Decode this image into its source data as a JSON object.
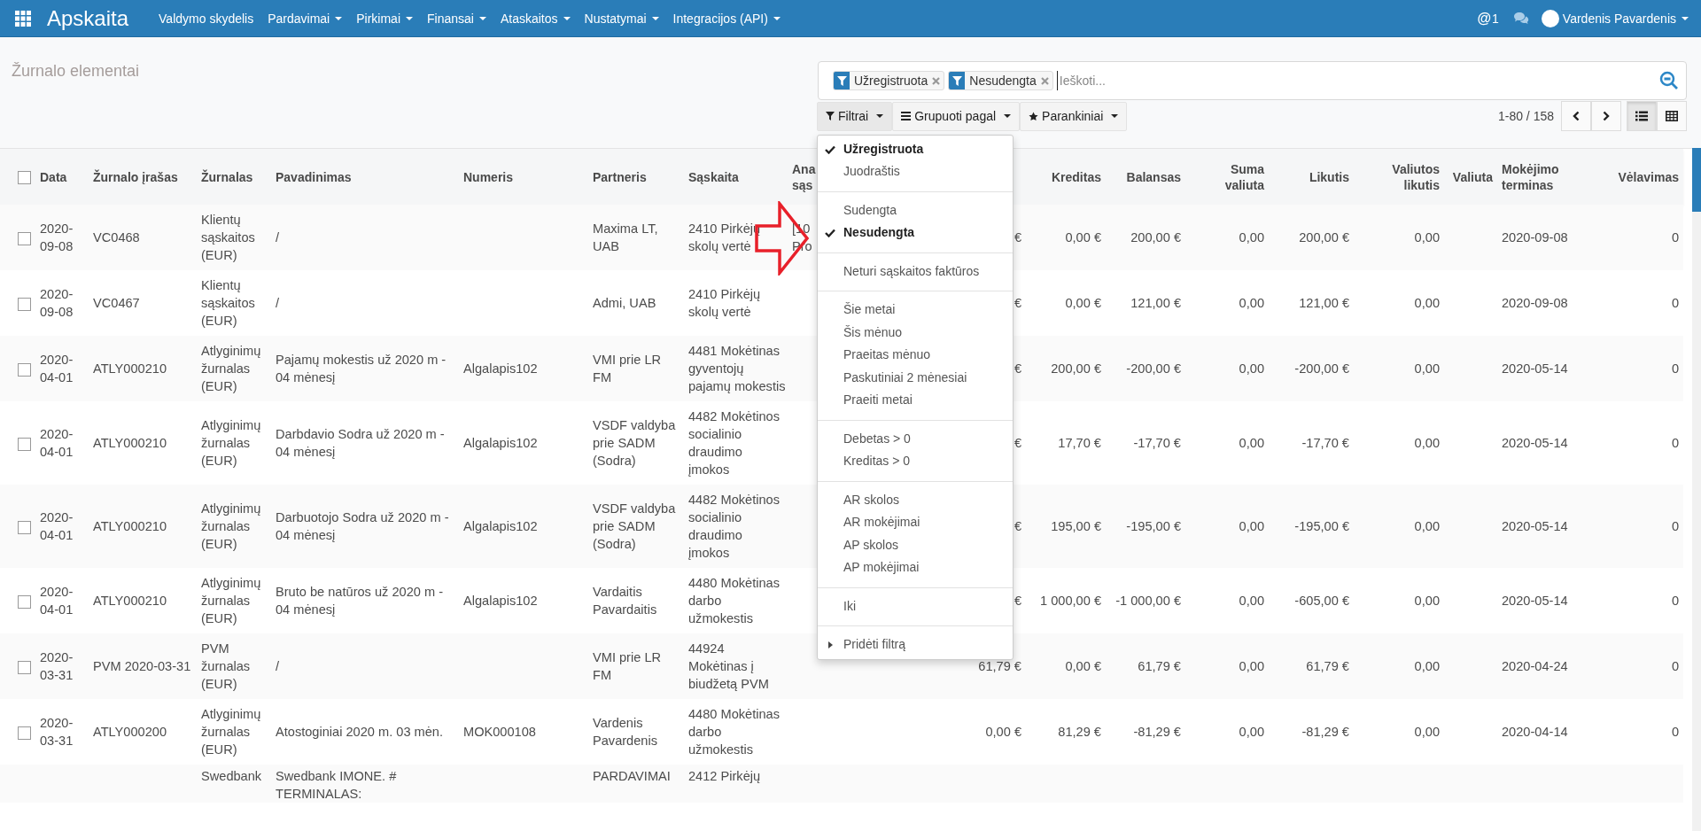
{
  "nav": {
    "app_title": "Apskaita",
    "menus": [
      {
        "label": "Valdymo skydelis",
        "caret": false
      },
      {
        "label": "Pardavimai",
        "caret": true
      },
      {
        "label": "Pirkimai",
        "caret": true
      },
      {
        "label": "Finansai",
        "caret": true
      },
      {
        "label": "Ataskaitos",
        "caret": true
      },
      {
        "label": "Nustatymai",
        "caret": true
      },
      {
        "label": "Integracijos (API)",
        "caret": true
      }
    ],
    "mention_glyph": "@",
    "mention_count": "1",
    "user": "Vardenis Pavardenis"
  },
  "page_title": "Žurnalo elementai",
  "search": {
    "facets": [
      {
        "label": "Užregistruota"
      },
      {
        "label": "Nesudengta"
      }
    ],
    "placeholder": "Ieškoti..."
  },
  "toolbar": [
    {
      "kind": "filter",
      "label": "Filtrai",
      "expanded": true
    },
    {
      "kind": "group",
      "label": "Grupuoti pagal",
      "expanded": false
    },
    {
      "kind": "favorite",
      "label": "Parankiniai",
      "expanded": false
    }
  ],
  "pager": "1-80 / 158",
  "views": [
    {
      "kind": "list",
      "selected": true
    },
    {
      "kind": "grid",
      "selected": false
    }
  ],
  "filter_menu": [
    [
      {
        "label": "Užregistruota",
        "checked": true
      },
      {
        "label": "Juodraštis",
        "checked": false
      }
    ],
    [
      {
        "label": "Sudengta",
        "checked": false
      },
      {
        "label": "Nesudengta",
        "checked": true
      }
    ],
    [
      {
        "label": "Neturi sąskaitos faktūros",
        "checked": false
      }
    ],
    [
      {
        "label": "Šie metai",
        "checked": false
      },
      {
        "label": "Šis mėnuo",
        "checked": false
      },
      {
        "label": "Praeitas mėnuo",
        "checked": false
      },
      {
        "label": "Paskutiniai 2 mėnesiai",
        "checked": false
      },
      {
        "label": "Praeiti metai",
        "checked": false
      }
    ],
    [
      {
        "label": "Debetas > 0",
        "checked": false
      },
      {
        "label": "Kreditas > 0",
        "checked": false
      }
    ],
    [
      {
        "label": "AR skolos",
        "checked": false
      },
      {
        "label": "AR mokėjimai",
        "checked": false
      },
      {
        "label": "AP skolos",
        "checked": false
      },
      {
        "label": "AP mokėjimai",
        "checked": false
      }
    ],
    [
      {
        "label": "Iki",
        "checked": false
      }
    ],
    [
      {
        "label": "Pridėti filtrą",
        "checked": false,
        "kind": "submenu"
      }
    ]
  ],
  "table": {
    "all_selected": false,
    "columns": [
      {
        "label": "Data",
        "kind": "text"
      },
      {
        "label": "Žurnalo įrašas",
        "kind": "text"
      },
      {
        "label": "Žurnalas",
        "kind": "text"
      },
      {
        "label": "Pavadinimas",
        "kind": "text"
      },
      {
        "label": "Numeris",
        "kind": "text"
      },
      {
        "label": "Partneris",
        "kind": "text"
      },
      {
        "label": "Sąskaita",
        "kind": "text"
      },
      {
        "label": "Ana sąs",
        "kind": "text"
      },
      {
        "kind": "number"
      },
      {
        "label": "Kreditas",
        "kind": "number"
      },
      {
        "label": "Balansas",
        "kind": "number"
      },
      {
        "label": "Suma valiuta",
        "kind": "number"
      },
      {
        "label": "Likutis",
        "kind": "number"
      },
      {
        "label": "Valiutos likutis",
        "kind": "number"
      },
      {
        "label": "Valiuta",
        "kind": "number"
      },
      {
        "label": "Mokėjimo terminas",
        "kind": "text"
      },
      {
        "label": "Vėlavimas",
        "kind": "number"
      }
    ],
    "rows": [
      {
        "checked": false,
        "date": "2020-09-08",
        "entry": "VC0468",
        "journal": "Klientų sąskaitos (EUR)",
        "name": "/",
        "partner": "Maxima LT, UAB",
        "account": "2410 Pirkėjų skolų vertė",
        "analytic": "[10 Pro",
        "debit": "€",
        "credit": "0,00 €",
        "balance": "200,00 €",
        "amount_currency": "0,00",
        "residual": "200,00 €",
        "residual_currency": "0,00",
        "due": "2020-09-08",
        "delay": "0"
      },
      {
        "checked": false,
        "date": "2020-09-08",
        "entry": "VC0467",
        "journal": "Klientų sąskaitos (EUR)",
        "name": "/",
        "partner": "Admi, UAB",
        "account": "2410 Pirkėjų skolų vertė",
        "debit": "€",
        "credit": "0,00 €",
        "balance": "121,00 €",
        "amount_currency": "0,00",
        "residual": "121,00 €",
        "residual_currency": "0,00",
        "due": "2020-09-08",
        "delay": "0"
      },
      {
        "checked": false,
        "date": "2020-04-01",
        "entry": "ATLY000210",
        "journal": "Atlyginimų žurnalas (EUR)",
        "name": "Pajamų mokestis už 2020 m - 04 mėnesį",
        "number": "Algalapis102",
        "partner": "VMI prie LR FM",
        "account": "4481 Mokėtinas gyventojų pajamų mokestis",
        "debit": "€",
        "credit": "200,00 €",
        "balance": "-200,00 €",
        "amount_currency": "0,00",
        "residual": "-200,00 €",
        "residual_currency": "0,00",
        "due": "2020-05-14",
        "delay": "0"
      },
      {
        "checked": false,
        "date": "2020-04-01",
        "entry": "ATLY000210",
        "journal": "Atlyginimų žurnalas (EUR)",
        "name": "Darbdavio Sodra už 2020 m - 04 mėnesį",
        "number": "Algalapis102",
        "partner": "VSDF valdyba prie SADM (Sodra)",
        "account": "4482 Mokėtinos socialinio draudimo įmokos",
        "debit": "€",
        "credit": "17,70 €",
        "balance": "-17,70 €",
        "amount_currency": "0,00",
        "residual": "-17,70 €",
        "residual_currency": "0,00",
        "due": "2020-05-14",
        "delay": "0"
      },
      {
        "checked": false,
        "date": "2020-04-01",
        "entry": "ATLY000210",
        "journal": "Atlyginimų žurnalas (EUR)",
        "name": "Darbuotojo Sodra už 2020 m - 04 mėnesį",
        "number": "Algalapis102",
        "partner": "VSDF valdyba prie SADM (Sodra)",
        "account": "4482 Mokėtinos socialinio draudimo įmokos",
        "debit": "€",
        "credit": "195,00 €",
        "balance": "-195,00 €",
        "amount_currency": "0,00",
        "residual": "-195,00 €",
        "residual_currency": "0,00",
        "due": "2020-05-14",
        "delay": "0"
      },
      {
        "checked": false,
        "date": "2020-04-01",
        "entry": "ATLY000210",
        "journal": "Atlyginimų žurnalas (EUR)",
        "name": "Bruto be natūros už 2020 m - 04 mėnesį",
        "number": "Algalapis102",
        "partner": "Vardaitis Pavardaitis",
        "account": "4480 Mokėtinas darbo užmokestis",
        "debit": "€",
        "credit": "1 000,00 €",
        "balance": "-1 000,00 €",
        "amount_currency": "0,00",
        "residual": "-605,00 €",
        "residual_currency": "0,00",
        "due": "2020-05-14",
        "delay": "0"
      },
      {
        "checked": false,
        "date": "2020-03-31",
        "entry": "PVM 2020-03-31",
        "journal": "PVM žurnalas (EUR)",
        "name": "/",
        "partner": "VMI prie LR FM",
        "account": "44924 Mokėtinas į biudžetą PVM",
        "debit": "61,79 €",
        "credit": "0,00 €",
        "balance": "61,79 €",
        "amount_currency": "0,00",
        "residual": "61,79 €",
        "residual_currency": "0,00",
        "due": "2020-04-24",
        "delay": "0"
      },
      {
        "checked": false,
        "date": "2020-03-31",
        "entry": "ATLY000200",
        "journal": "Atlyginimų žurnalas (EUR)",
        "name": "Atostoginiai 2020 m. 03 mėn.",
        "number": "MOK000108",
        "partner": "Vardenis Pavardenis",
        "account": "4480 Mokėtinas darbo užmokestis",
        "debit": "0,00 €",
        "credit": "81,29 €",
        "balance": "-81,29 €",
        "amount_currency": "0,00",
        "residual": "-81,29 €",
        "residual_currency": "0,00",
        "due": "2020-04-14",
        "delay": "0"
      }
    ],
    "partial_row": {
      "journal": "Swedbank",
      "name": "Swedbank IMONE. # TERMINALAS:",
      "partner": "PARDAVIMAI",
      "account": "2412 Pirkėjų"
    }
  }
}
